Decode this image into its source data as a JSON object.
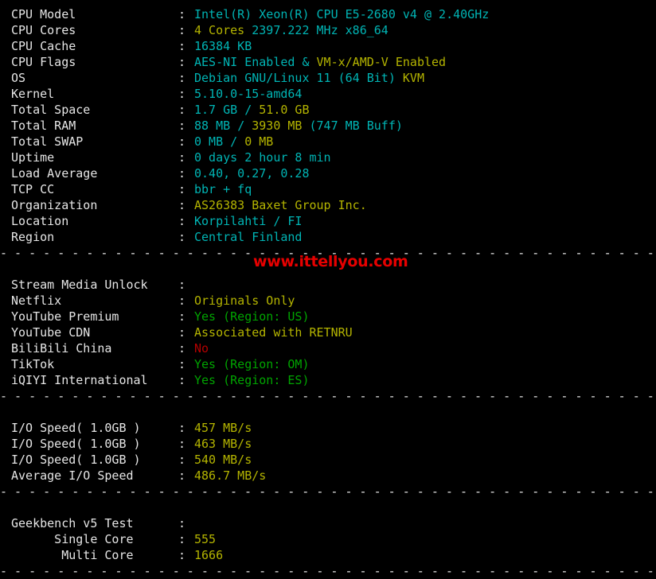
{
  "terminal": {
    "background": "#000000",
    "colors": {
      "label": "#e6e6e6",
      "cyan": "#00b4b4",
      "yellow": "#b4b400",
      "green": "#00a400",
      "red": "#b40000",
      "watermark": "#e60000"
    },
    "divider_char": "-",
    "divider_line": "- - - - - - - - - - - - - - - - - - - - - - - - - - - - - - - - - - - - - - - - - - - - - - - - - - - - - - - - - - - - - - - - - - - - - - - - - - - - - - - - - - - - -"
  },
  "watermark": {
    "text": "www.ittellyou.com"
  },
  "system": {
    "rows": [
      {
        "label": "CPU Model",
        "colon": ":",
        "parts": [
          {
            "text": "Intel(R) Xeon(R) CPU E5-2680 v4 @ 2.40GHz",
            "color": "cyan"
          }
        ]
      },
      {
        "label": "CPU Cores",
        "colon": ":",
        "parts": [
          {
            "text": "4 Cores",
            "color": "yellow"
          },
          {
            "text": " 2397.222 MHz x86_64",
            "color": "cyan"
          }
        ]
      },
      {
        "label": "CPU Cache",
        "colon": ":",
        "parts": [
          {
            "text": "16384 KB",
            "color": "cyan"
          }
        ]
      },
      {
        "label": "CPU Flags",
        "colon": ":",
        "parts": [
          {
            "text": "AES-NI Enabled",
            "color": "cyan"
          },
          {
            "text": " & ",
            "color": "cyan"
          },
          {
            "text": "VM-x/AMD-V Enabled",
            "color": "yellow"
          }
        ]
      },
      {
        "label": "OS",
        "colon": ":",
        "parts": [
          {
            "text": "Debian GNU/Linux 11 (64 Bit) ",
            "color": "cyan"
          },
          {
            "text": "KVM",
            "color": "yellow"
          }
        ]
      },
      {
        "label": "Kernel",
        "colon": ":",
        "parts": [
          {
            "text": "5.10.0-15-amd64",
            "color": "cyan"
          }
        ]
      },
      {
        "label": "Total Space",
        "colon": ":",
        "parts": [
          {
            "text": "1.7 GB ",
            "color": "cyan"
          },
          {
            "text": "/ ",
            "color": "cyan"
          },
          {
            "text": "51.0 GB",
            "color": "yellow"
          }
        ]
      },
      {
        "label": "Total RAM",
        "colon": ":",
        "parts": [
          {
            "text": "88 MB ",
            "color": "cyan"
          },
          {
            "text": "/ ",
            "color": "cyan"
          },
          {
            "text": "3930 MB ",
            "color": "yellow"
          },
          {
            "text": "(747 MB Buff)",
            "color": "cyan"
          }
        ]
      },
      {
        "label": "Total SWAP",
        "colon": ":",
        "parts": [
          {
            "text": "0 MB ",
            "color": "cyan"
          },
          {
            "text": "/ ",
            "color": "cyan"
          },
          {
            "text": "0 MB",
            "color": "yellow"
          }
        ]
      },
      {
        "label": "Uptime",
        "colon": ":",
        "parts": [
          {
            "text": "0 days 2 hour 8 min",
            "color": "cyan"
          }
        ]
      },
      {
        "label": "Load Average",
        "colon": ":",
        "parts": [
          {
            "text": "0.40, 0.27, 0.28",
            "color": "cyan"
          }
        ]
      },
      {
        "label": "TCP CC",
        "colon": ":",
        "parts": [
          {
            "text": "bbr + fq",
            "color": "cyan"
          }
        ]
      },
      {
        "label": "Organization",
        "colon": ":",
        "parts": [
          {
            "text": "AS26383 Baxet Group Inc.",
            "color": "yellow"
          }
        ]
      },
      {
        "label": "Location",
        "colon": ":",
        "parts": [
          {
            "text": "Korpilahti / FI",
            "color": "cyan"
          }
        ]
      },
      {
        "label": "Region",
        "colon": ":",
        "parts": [
          {
            "text": "Central Finland",
            "color": "cyan"
          }
        ]
      }
    ]
  },
  "stream_media": {
    "rows": [
      {
        "label": "Stream Media Unlock",
        "colon": ":",
        "parts": []
      },
      {
        "label": "Netflix",
        "colon": ":",
        "parts": [
          {
            "text": "Originals Only",
            "color": "yellow"
          }
        ]
      },
      {
        "label": "YouTube Premium",
        "colon": ":",
        "parts": [
          {
            "text": "Yes (Region: US)",
            "color": "green"
          }
        ]
      },
      {
        "label": "YouTube CDN",
        "colon": ":",
        "parts": [
          {
            "text": "Associated with RETNRU",
            "color": "yellow"
          }
        ]
      },
      {
        "label": "BiliBili China",
        "colon": ":",
        "parts": [
          {
            "text": "No",
            "color": "red"
          }
        ]
      },
      {
        "label": "TikTok",
        "colon": ":",
        "parts": [
          {
            "text": "Yes (Region: OM)",
            "color": "green"
          }
        ]
      },
      {
        "label": "iQIYI International",
        "colon": ":",
        "parts": [
          {
            "text": "Yes (Region: ES)",
            "color": "green"
          }
        ]
      }
    ]
  },
  "io_speed": {
    "rows": [
      {
        "label": "I/O Speed( 1.0GB )",
        "colon": ":",
        "parts": [
          {
            "text": "457 MB/s",
            "color": "yellow"
          }
        ]
      },
      {
        "label": "I/O Speed( 1.0GB )",
        "colon": ":",
        "parts": [
          {
            "text": "463 MB/s",
            "color": "yellow"
          }
        ]
      },
      {
        "label": "I/O Speed( 1.0GB )",
        "colon": ":",
        "parts": [
          {
            "text": "540 MB/s",
            "color": "yellow"
          }
        ]
      },
      {
        "label": "Average I/O Speed",
        "colon": ":",
        "parts": [
          {
            "text": "486.7 MB/s",
            "color": "yellow"
          }
        ]
      }
    ]
  },
  "geekbench": {
    "rows": [
      {
        "label": "Geekbench v5 Test",
        "colon": ":",
        "parts": []
      },
      {
        "label": "      Single Core",
        "colon": ":",
        "parts": [
          {
            "text": "555",
            "color": "yellow"
          }
        ]
      },
      {
        "label": "       Multi Core",
        "colon": ":",
        "parts": [
          {
            "text": "1666",
            "color": "yellow"
          }
        ]
      }
    ]
  }
}
